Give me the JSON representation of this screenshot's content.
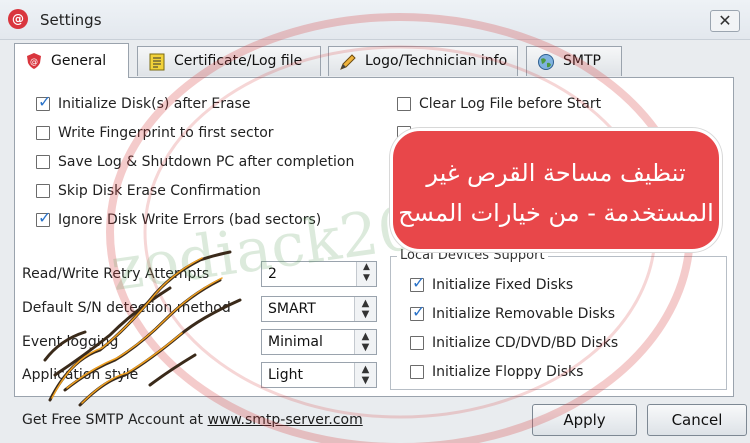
{
  "window": {
    "title": "Settings",
    "close_glyph": "✕"
  },
  "tabs": [
    {
      "label": "General",
      "icon": "shield-icon",
      "active": true
    },
    {
      "label": "Certificate/Log file",
      "icon": "document-icon",
      "active": false
    },
    {
      "label": "Logo/Technician info",
      "icon": "pencil-icon",
      "active": false
    },
    {
      "label": "SMTP",
      "icon": "globe-icon",
      "active": false
    }
  ],
  "options_left": [
    {
      "label": "Initialize Disk(s) after Erase",
      "checked": true
    },
    {
      "label": "Write Fingerprint to first sector",
      "checked": false
    },
    {
      "label": "Save Log & Shutdown PC after completion",
      "checked": false
    },
    {
      "label": "Skip Disk Erase Confirmation",
      "checked": false
    },
    {
      "label": "Ignore Disk Write Errors (bad sectors)",
      "checked": true
    }
  ],
  "options_right": [
    {
      "label": "Clear Log File before Start",
      "checked": false
    }
  ],
  "fields": {
    "retry_label": "Read/Write Retry Attempts",
    "retry_value": "2",
    "sn_label": "Default S/N detection method",
    "sn_value": "SMART",
    "event_label": "Event logging",
    "event_value": "Minimal",
    "style_label": "Application style",
    "style_value": "Light"
  },
  "local_devices": {
    "title": "Local Devices Support",
    "items": [
      {
        "label": "Initialize Fixed Disks",
        "checked": true
      },
      {
        "label": "Initialize Removable Disks",
        "checked": true
      },
      {
        "label": "Initialize CD/DVD/BD Disks",
        "checked": false
      },
      {
        "label": "Initialize Floppy Disks",
        "checked": false
      }
    ]
  },
  "footer": {
    "prefix": "Get Free SMTP Account at ",
    "link": "www.smtp-server.com",
    "apply": "Apply",
    "cancel": "Cancel"
  },
  "overlay": {
    "banner_line1": "تنظيف مساحة القرص غير",
    "banner_line2": "المستخدمة - من خيارات المسح",
    "watermark": "zodiack2002"
  },
  "colors": {
    "banner": "#e8474a",
    "checkmark": "#2b73c9",
    "watermark": "#d64545"
  }
}
